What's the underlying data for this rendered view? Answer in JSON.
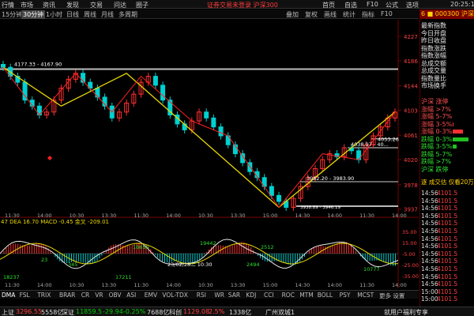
{
  "menu": {
    "items": [
      "行情",
      "市场",
      "资讯",
      "发现",
      "交易",
      "问达",
      "圈子"
    ],
    "banner": "证券交易未登录  沪深300",
    "right_items": [
      "首页",
      "自选",
      "F10",
      "公式",
      "选项"
    ],
    "clock": "20:25:13"
  },
  "toolbar": {
    "items": [
      "15分钟",
      "30分钟",
      "1小时",
      "日线",
      "周线",
      "月线",
      "多周期"
    ],
    "active_index": 1,
    "right_items": [
      "叠加",
      "复权",
      "画线",
      "统计",
      "指标",
      "F10"
    ]
  },
  "right_panel": {
    "title": "6 ■ 000300 沪深300",
    "info_labels": [
      "最新指数",
      "今日开盘",
      "昨日收盘",
      "指数涨跌",
      "指数涨幅",
      "总成交额",
      "总成交量",
      "指数量比",
      "市场换手"
    ],
    "dist_labels": [
      "沪深 涨停",
      "涨幅 >7%",
      "涨幅 5-7%",
      "涨幅 3-5%",
      "涨幅 0-3%",
      "跌幅 0-3%",
      "跌幅 3-5%",
      "跌幅 5-7%",
      "跌幅 >7%",
      "沪深 跌停"
    ],
    "dist_bars": [
      0,
      0,
      0,
      0.05,
      0.55,
      0.85,
      0.2,
      0,
      0,
      0
    ],
    "ticks_header": "逐 成交估  仅看20万",
    "ticks": [
      {
        "time": "14:56",
        "value": "4101.5"
      },
      {
        "time": "14:56",
        "value": "4101.5"
      },
      {
        "time": "14:56",
        "value": "4101.5"
      },
      {
        "time": "14:56",
        "value": "4101.5"
      },
      {
        "time": "14:56",
        "value": "4101.5"
      },
      {
        "time": "14:56",
        "value": "4101.5"
      },
      {
        "time": "14:56",
        "value": "4101.5"
      },
      {
        "time": "14:56",
        "value": "4101.5"
      },
      {
        "time": "14:56",
        "value": "4101.5"
      },
      {
        "time": "14:56",
        "value": "4101.5"
      },
      {
        "time": "14:56",
        "value": "4101.5"
      },
      {
        "time": "14:56",
        "value": "4101.5"
      },
      {
        "time": "14:56",
        "value": "4101.5"
      },
      {
        "time": "15:00",
        "value": "4101.5"
      },
      {
        "time": "15:00",
        "value": "4101.5"
      }
    ]
  },
  "chart": {
    "labels": {
      "high_level": "4177.33 - 4167.90",
      "mid_level": "4053.26",
      "mid_range": "4038.97 - 40...",
      "low_range": "3982.20 - 3983.90",
      "low_level": "3938.89 - 3946.19",
      "macd_line": "47  DEA 16.70  MACD -0.45  金叉 -209.01",
      "macd_values": [
        "18237",
        "16656",
        "17211",
        "19442",
        "10777",
        "2494",
        "345",
        "23",
        "2512"
      ],
      "date_tag": "23/02/28二 10:30"
    },
    "price_ticks": [
      "4227",
      "4186",
      "4144",
      "4103",
      "4061",
      "4020",
      "3978",
      "3937"
    ],
    "macd_ticks": [
      "35.00",
      "15.00",
      "-5.00",
      "-25.00",
      "-35.00"
    ],
    "time_ticks": [
      "11:30",
      "14:00",
      "10:30",
      "13:30",
      "11:30",
      "14:00",
      "10:30",
      "13:30",
      "15:00",
      "14:30",
      "14:00",
      "11:30",
      "14:00"
    ]
  },
  "chart_data": {
    "type": "line",
    "title": "000300 沪深300 30分钟",
    "ylim": [
      3930,
      4235
    ],
    "series": [
      {
        "name": "沪深300",
        "values": [
          4175,
          4160,
          4150,
          4120,
          4110,
          4095,
          4100,
          4120,
          4140,
          4155,
          4165,
          4150,
          4140,
          4125,
          4110,
          4090,
          4100,
          4115,
          4130,
          4150,
          4160,
          4145,
          4120,
          4095,
          4080,
          4070,
          4085,
          4100,
          4090,
          4075,
          4060,
          4045,
          4030,
          4015,
          4000,
          3990,
          3975,
          3960,
          3950,
          3940,
          3955,
          3975,
          3990,
          4005,
          4020,
          4030,
          4025,
          4040,
          4035,
          4020,
          4045,
          4060,
          4075,
          4090,
          4100
        ]
      }
    ]
  },
  "indicators": [
    "DMA",
    "FSL",
    "TRIX",
    "BRAR",
    "CR",
    "VR",
    "OBV",
    "ASI",
    "EMV",
    "VOL-TDX",
    "RSI",
    "WR",
    "SAR",
    "KDJ",
    "CCI",
    "ROC",
    "MTM",
    "BOLL",
    "PSY",
    "MCST",
    "更多",
    "设置"
  ],
  "status": {
    "sh_label": "上证",
    "sh_value": "3296.55",
    "sh_vol": "5558亿",
    "sz_label": "深证",
    "sz_value": "11859.5",
    "sz_chg": "-29.94",
    "sz_pct": "-0.25%",
    "sz_vol": "7688亿",
    "cy_label": "科创",
    "cy_value": "1129.08",
    "cy_pct": "2.5%",
    "cy_vol": "1338亿",
    "extra": "广州双城1",
    "right": "就用户福利专享"
  },
  "colors": {
    "up": "#ff3030",
    "down": "#00d0d0",
    "trend": "#e8d800",
    "accent": "#ffd400"
  }
}
